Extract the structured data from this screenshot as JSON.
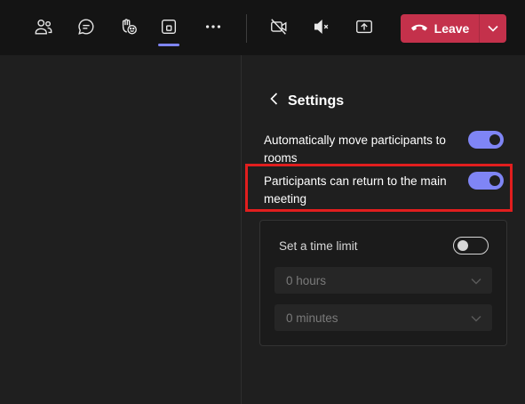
{
  "toolbar": {
    "icons": [
      "people-icon",
      "chat-icon",
      "raise-hand-icon",
      "rooms-icon",
      "more-icon",
      "camera-off-icon",
      "mic-muted-icon",
      "share-icon"
    ],
    "leave_label": "Leave",
    "accent_color": "#7f85f5",
    "leave_color": "#c4314b"
  },
  "settings": {
    "title": "Settings",
    "items": [
      {
        "label": "Automatically move participants to rooms",
        "enabled": true
      },
      {
        "label": "Participants can return to the main meeting",
        "enabled": true
      }
    ],
    "time_limit": {
      "label": "Set a time limit",
      "enabled": false,
      "hours_value": "0 hours",
      "minutes_value": "0 minutes"
    }
  }
}
